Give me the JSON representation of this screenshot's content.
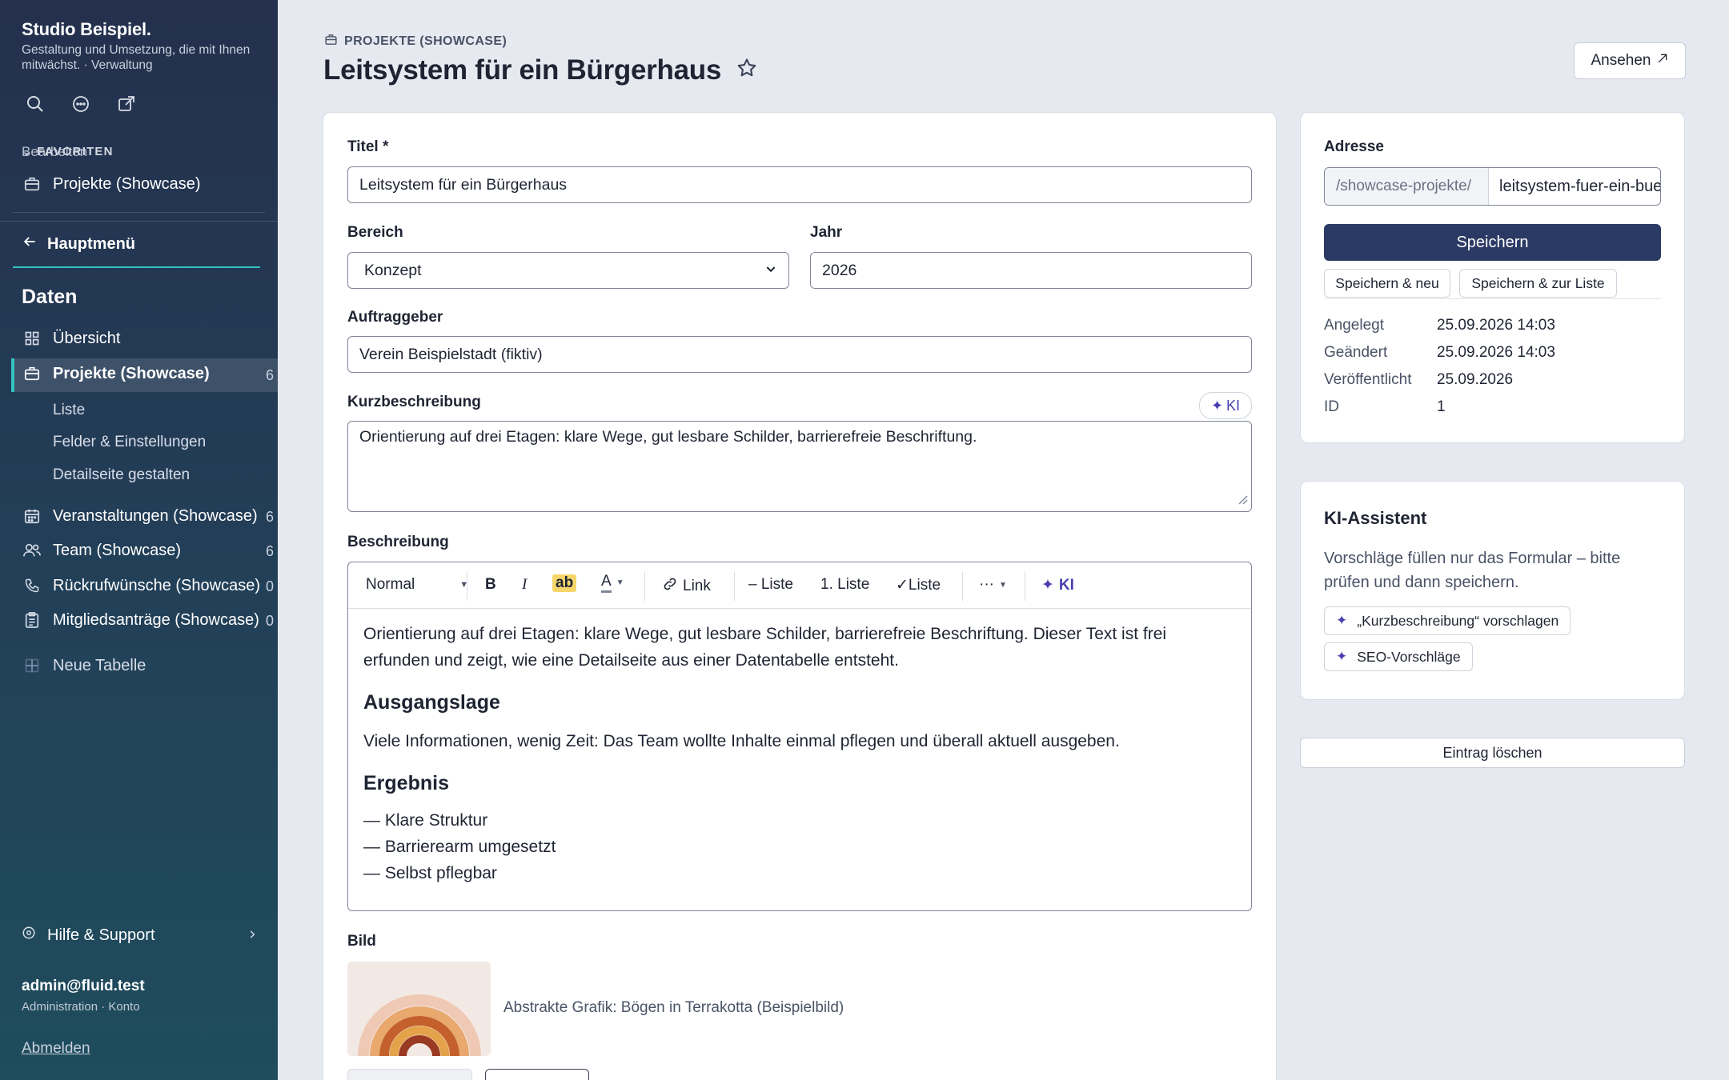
{
  "sidebar": {
    "brand_title": "Studio Beispiel.",
    "brand_subtitle": "Gestaltung und Umsetzung, die mit Ihnen mitwächst. · Verwaltung",
    "favorites_label": "FAVORITEN",
    "favorites_edit": "Bearbeiten",
    "favorite_item": "Projekte (Showcase)",
    "main_menu": "Hauptmenü",
    "section_title": "Daten",
    "nav": [
      {
        "label": "Übersicht",
        "icon": "grid-icon"
      },
      {
        "label": "Projekte (Showcase)",
        "count": "6",
        "icon": "briefcase-icon",
        "active": true
      },
      {
        "label": "Veranstaltungen (Showcase)",
        "count": "6",
        "icon": "calendar-icon"
      },
      {
        "label": "Team (Showcase)",
        "count": "6",
        "icon": "users-icon"
      },
      {
        "label": "Rückrufwünsche (Showcase)",
        "count": "0",
        "icon": "phone-icon"
      },
      {
        "label": "Mitgliedsanträge (Showcase)",
        "count": "0",
        "icon": "clipboard-icon"
      },
      {
        "label": "Neue Tabelle",
        "icon": "plus-icon"
      }
    ],
    "sub_items": [
      "Liste",
      "Felder & Einstellungen",
      "Detailseite gestalten"
    ],
    "help": "Hilfe & Support",
    "user_email": "admin@fluid.test",
    "user_role": "Administration · Konto",
    "logout": "Abmelden"
  },
  "header": {
    "breadcrumb": "PROJEKTE (SHOWCASE)",
    "title": "Leitsystem für ein Bürgerhaus",
    "view_button": "Ansehen"
  },
  "form": {
    "title_label": "Titel *",
    "title_value": "Leitsystem für ein Bürgerhaus",
    "area_label": "Bereich",
    "area_value": "Konzept",
    "year_label": "Jahr",
    "year_value": "2026",
    "client_label": "Auftraggeber",
    "client_value": "Verein Beispielstadt (fiktiv)",
    "short_label": "Kurzbeschreibung",
    "short_value": "Orientierung auf drei Etagen: klare Wege, gut lesbare Schilder, barrierefreie Beschriftung.",
    "ki_label": "KI",
    "desc_label": "Beschreibung",
    "toolbar": {
      "style": "Normal",
      "bold": "B",
      "italic": "I",
      "highlight": "ab",
      "color": "A",
      "link": "Link",
      "bullet": "– Liste",
      "numbered": "1. Liste",
      "check": "✓Liste",
      "more": "···",
      "ki": "KI"
    },
    "content": {
      "p1a": "Orientierung auf drei Etagen: klare Wege, gut lesbare Schilder, barrierefreie Beschriftung. Dieser Text ist frei",
      "p1b": "erfunden und zeigt, wie eine Detailseite aus einer Datentabelle entsteht.",
      "h1": "Ausgangslage",
      "p2": "Viele Informationen, wenig Zeit: Das Team wollte Inhalte einmal pflegen und überall aktuell ausgeben.",
      "h2": "Ergebnis",
      "list": [
        "— Klare Struktur",
        "— Barrierearm umgesetzt",
        "— Selbst pflegbar"
      ]
    },
    "image_label": "Bild",
    "image_caption": "Abstrakte Grafik: Bögen in Terrakotta (Beispielbild)"
  },
  "address": {
    "label": "Adresse",
    "prefix": "/showcase-projekte/",
    "slug": "leitsystem-fuer-ein-buergerhaus",
    "save": "Speichern",
    "save_new": "Speichern & neu",
    "save_list": "Speichern & zur Liste",
    "meta": [
      {
        "key": "Angelegt",
        "value": "25.09.2026 14:03"
      },
      {
        "key": "Geändert",
        "value": "25.09.2026 14:03"
      },
      {
        "key": "Veröffentlicht",
        "value": "25.09.2026"
      },
      {
        "key": "ID",
        "value": "1"
      }
    ]
  },
  "assistant": {
    "title": "KI-Assistent",
    "text": "Vorschläge füllen nur das Formular – bitte prüfen und dann speichern.",
    "suggest_short": "„Kurzbeschreibung“ vorschlagen",
    "seo": "SEO-Vorschläge"
  },
  "delete_button": "Eintrag löschen",
  "colors": {
    "accent": "#35c2c4",
    "primary": "#2b3a64",
    "ki": "#4a3fb0"
  }
}
